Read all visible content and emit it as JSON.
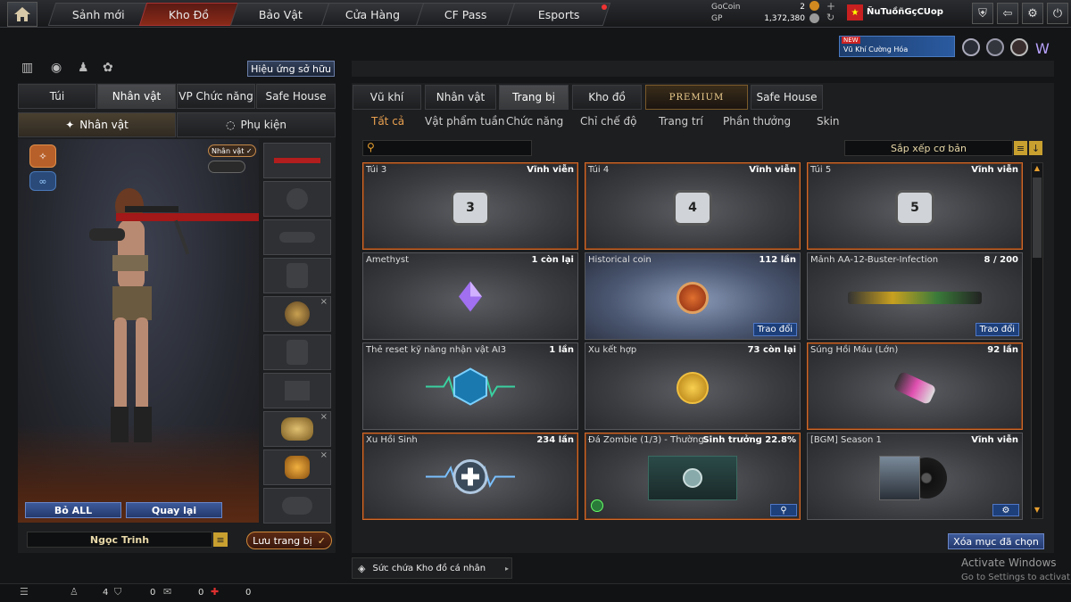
{
  "topnav": {
    "tabs": [
      {
        "label": "Sảnh mới"
      },
      {
        "label": "Kho Đồ"
      },
      {
        "label": "Bảo Vật"
      },
      {
        "label": "Cửa Hàng"
      },
      {
        "label": "CF Pass"
      },
      {
        "label": "Esports"
      }
    ],
    "gocoin_label": "GoCoin",
    "gocoin_value": "2",
    "gp_label": "GP",
    "gp_value": "1,372,380",
    "username": "ÑuTuồñGçCUop"
  },
  "banner": {
    "new_badge": "NEW",
    "text": "Vũ Khí Cường Hóa"
  },
  "left": {
    "effect_button": "Hiệu ứng sở hữu",
    "tabs": [
      "Túi",
      "Nhân vật",
      "VP Chức năng",
      "Safe House"
    ],
    "subtabs": [
      "Nhân vật",
      "Phụ kiện"
    ],
    "tag": "Nhân vật ✓",
    "bo_all": "Bỏ ALL",
    "quay_lai": "Quay lại",
    "character_name": "Ngọc Trinh",
    "save_button": "Lưu trang bị"
  },
  "right": {
    "tabs": [
      "Vũ khí",
      "Nhân vật",
      "Trang bị",
      "Kho đồ",
      "PREMIUM",
      "Safe House"
    ],
    "subtabs": [
      "Tất cả",
      "Vật phẩm tuần",
      "Chức năng",
      "Chỉ chế độ",
      "Trang trí",
      "Phần thưởng",
      "Skin"
    ],
    "search_placeholder": "",
    "sort_label": "Sắp xếp cơ bản",
    "items": [
      {
        "name": "Túi 3",
        "right": "Vĩnh viễn",
        "icon": "bag-3-icon"
      },
      {
        "name": "Túi 4",
        "right": "Vĩnh viễn",
        "icon": "bag-4-icon"
      },
      {
        "name": "Túi 5",
        "right": "Vĩnh viễn",
        "icon": "bag-5-icon"
      },
      {
        "name": "Amethyst",
        "right": "1 còn lại",
        "icon": "amethyst-icon"
      },
      {
        "name": "Historical coin",
        "right": "112 lần",
        "icon": "historical-coin-icon",
        "action": "Trao đổi"
      },
      {
        "name": "Mảnh AA-12-Buster-Infection",
        "right": "8 / 200",
        "icon": "shotgun-icon",
        "action": "Trao đổi"
      },
      {
        "name": "Thẻ reset kỹ năng nhận vật AI3",
        "right": "1 lần",
        "icon": "reset-card-icon"
      },
      {
        "name": "Xu kết hợp",
        "right": "73 còn lại",
        "icon": "gold-coin-icon"
      },
      {
        "name": "Súng Hồi Máu (Lớn)",
        "right": "92 lần",
        "icon": "heal-gun-icon"
      },
      {
        "name": "Xu Hồi Sinh",
        "right": "234 lần",
        "icon": "revive-coin-icon"
      },
      {
        "name": "Đá Zombie (1/3) - Thường",
        "right": "Sinh trưởng 22.8%",
        "icon": "zombie-stone-icon"
      },
      {
        "name": "[BGM] Season 1",
        "right": "Vĩnh viễn",
        "icon": "music-disc-icon"
      }
    ],
    "delete_selected": "Xóa mục đã chọn",
    "capacity_label": "Sức chứa Kho đồ cá nhân"
  },
  "bottom": {
    "count1": "4",
    "count2": "0",
    "count3": "0",
    "count4": "0"
  },
  "watermark": {
    "line1": "Activate Windows",
    "line2": "Go to Settings to activat"
  },
  "colors": {
    "accent": "#d06a2a",
    "button_blue": "#1d3f7a",
    "active_tab": "#8a2a18"
  }
}
